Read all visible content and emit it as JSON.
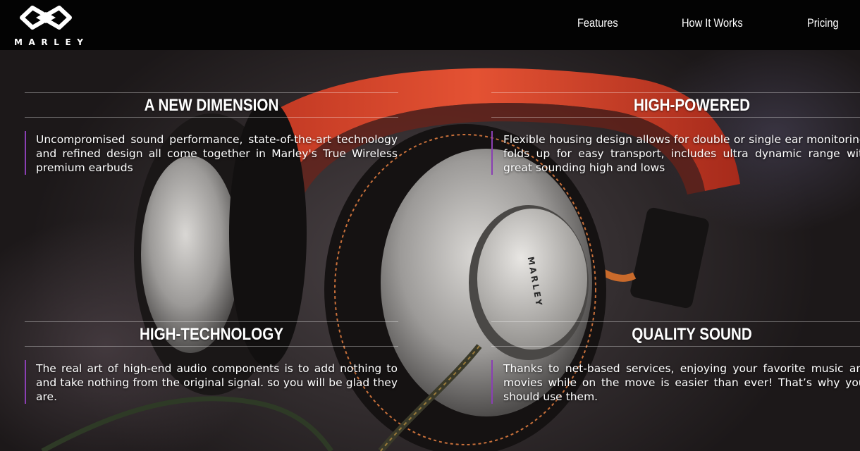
{
  "header": {
    "logo_word": "MARLEY",
    "nav": [
      {
        "label": "Features"
      },
      {
        "label": "How It Works"
      },
      {
        "label": "Pricing"
      }
    ]
  },
  "features": [
    {
      "title": "A NEW DIMENSION",
      "text": "Uncompromised sound performance, state-of-the-art technology and refined design all come together in Marley's True Wireless premium earbuds"
    },
    {
      "title": "HIGH-POWERED",
      "text": "Flexible housing design allows for double or single ear monitoring; folds up for easy transport, includes ultra dynamic range with great sounding high and lows"
    },
    {
      "title": "HIGH-TECHNOLOGY",
      "text": "The real art of high-end audio components is to add nothing to and take nothing from the original signal. so you will be glad they are."
    },
    {
      "title": "QUALITY SOUND",
      "text": "Thanks to net-based services, enjoying your favorite music and movies while on the move is easier than ever! That’s why your should use them."
    }
  ],
  "hero": {
    "image": "headphones-photo",
    "earcup_brand": "MARLEY"
  },
  "colors": {
    "header_bg": "#030303",
    "accent_bar": "#8a3fb3",
    "headband": "#d8432a"
  }
}
